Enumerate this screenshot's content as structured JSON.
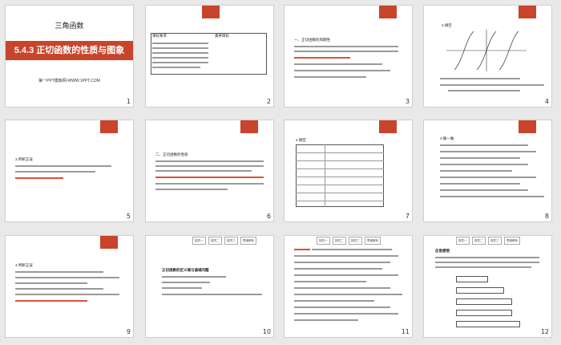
{
  "slides": [
    {
      "num": "1",
      "title": "三角函数",
      "subtitle": "5.4.3 正切函数的性质与图象",
      "footer": "第一PPT模板网-WWW.1PPT.COM"
    },
    {
      "num": "2",
      "tag": "",
      "box_label": "课标要求",
      "box_label2": "素养目标"
    },
    {
      "num": "3",
      "tag": "",
      "heading": "一、正切函数的周期性"
    },
    {
      "num": "4",
      "tag": "",
      "heading": "2.填空"
    },
    {
      "num": "5",
      "tag": "",
      "heading": "3.判断正误"
    },
    {
      "num": "6",
      "tag": "",
      "heading": "二、正切函数的性质"
    },
    {
      "num": "7",
      "tag": "",
      "heading": "2.填空"
    },
    {
      "num": "8",
      "tag": "",
      "heading": "3.做一做"
    },
    {
      "num": "9",
      "tag": "",
      "heading": "4.判断正误"
    },
    {
      "num": "10",
      "tag": "",
      "heading": "正切函数的定义域与值域问题"
    },
    {
      "num": "11",
      "tag": "",
      "heading": "答案"
    },
    {
      "num": "12",
      "tag": "",
      "heading": "反思感悟"
    }
  ],
  "tag_label": "课前·自主预习",
  "tabs": [
    "探究一",
    "探究二",
    "探究三",
    "思维辨析",
    "随堂演练"
  ]
}
